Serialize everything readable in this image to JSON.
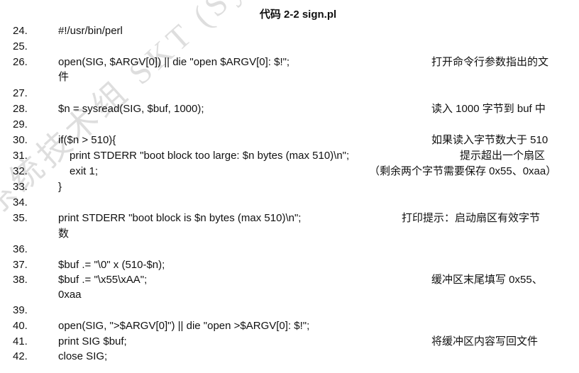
{
  "title": "代码  2-2 sign.pl",
  "watermark": "系统技术组 SKT (System Kernel Tech",
  "lines": [
    {
      "num": "24.",
      "code": "#!/usr/bin/perl",
      "comment": ""
    },
    {
      "num": "25.",
      "code": "",
      "comment": ""
    },
    {
      "num": "26.",
      "code": "open(SIG, $ARGV[0]) || die \"open $ARGV[0]: $!\";",
      "comment": "打开命令行参数指出的文",
      "wrap": "件"
    },
    {
      "num": "27.",
      "code": "",
      "comment": ""
    },
    {
      "num": "28.",
      "code": "$n = sysread(SIG, $buf, 1000);",
      "comment": "读入 1000 字节到 buf 中"
    },
    {
      "num": "29.",
      "code": "",
      "comment": ""
    },
    {
      "num": "30.",
      "code": "if($n > 510){",
      "comment": "如果读入字节数大于 510"
    },
    {
      "num": "31.",
      "code": "print STDERR \"boot block too large: $n bytes (max 510)\\n\";",
      "comment": "提示超出一个扇区"
    },
    {
      "num": "32.",
      "code": "exit 1;",
      "comment": "（剩余两个字节需要保存 0x55、0xaa）"
    },
    {
      "num": "33.",
      "code": "}",
      "comment": ""
    },
    {
      "num": "34.",
      "code": "",
      "comment": ""
    },
    {
      "num": "35.",
      "code": "print STDERR \"boot block is $n bytes (max 510)\\n\";",
      "comment": "打印提示：启动扇区有效字节",
      "wrap": "数"
    },
    {
      "num": "36.",
      "code": "",
      "comment": ""
    },
    {
      "num": "37.",
      "code": "$buf .= \"\\0\" x (510-$n);",
      "comment": ""
    },
    {
      "num": "38.",
      "code": "$buf .= \"\\x55\\xAA\";",
      "comment": "缓冲区末尾填写  0x55、",
      "wrap": "0xaa"
    },
    {
      "num": "39.",
      "code": "",
      "comment": ""
    },
    {
      "num": "40.",
      "code": "open(SIG, \">$ARGV[0]\") || die \"open >$ARGV[0]: $!\";",
      "comment": ""
    },
    {
      "num": "41.",
      "code": "print SIG $buf;",
      "comment": "将缓冲区内容写回文件"
    },
    {
      "num": "42.",
      "code": "close SIG;",
      "comment": ""
    }
  ]
}
